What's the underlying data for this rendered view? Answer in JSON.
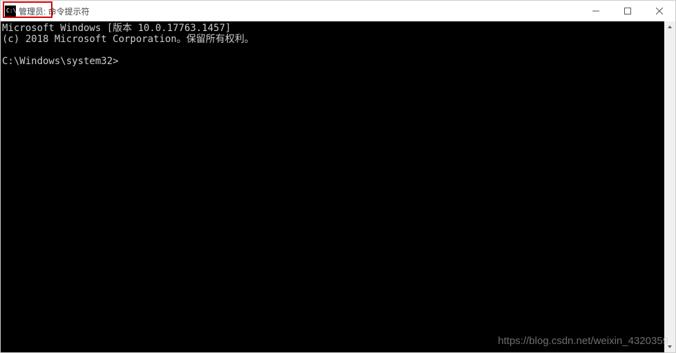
{
  "titlebar": {
    "title": "管理员: 命令提示符"
  },
  "terminal": {
    "line1": "Microsoft Windows [版本 10.0.17763.1457]",
    "line2": "(c) 2018 Microsoft Corporation。保留所有权利。",
    "blank": "",
    "prompt": "C:\\Windows\\system32>"
  },
  "watermark": "https://blog.csdn.net/weixin_4320359"
}
